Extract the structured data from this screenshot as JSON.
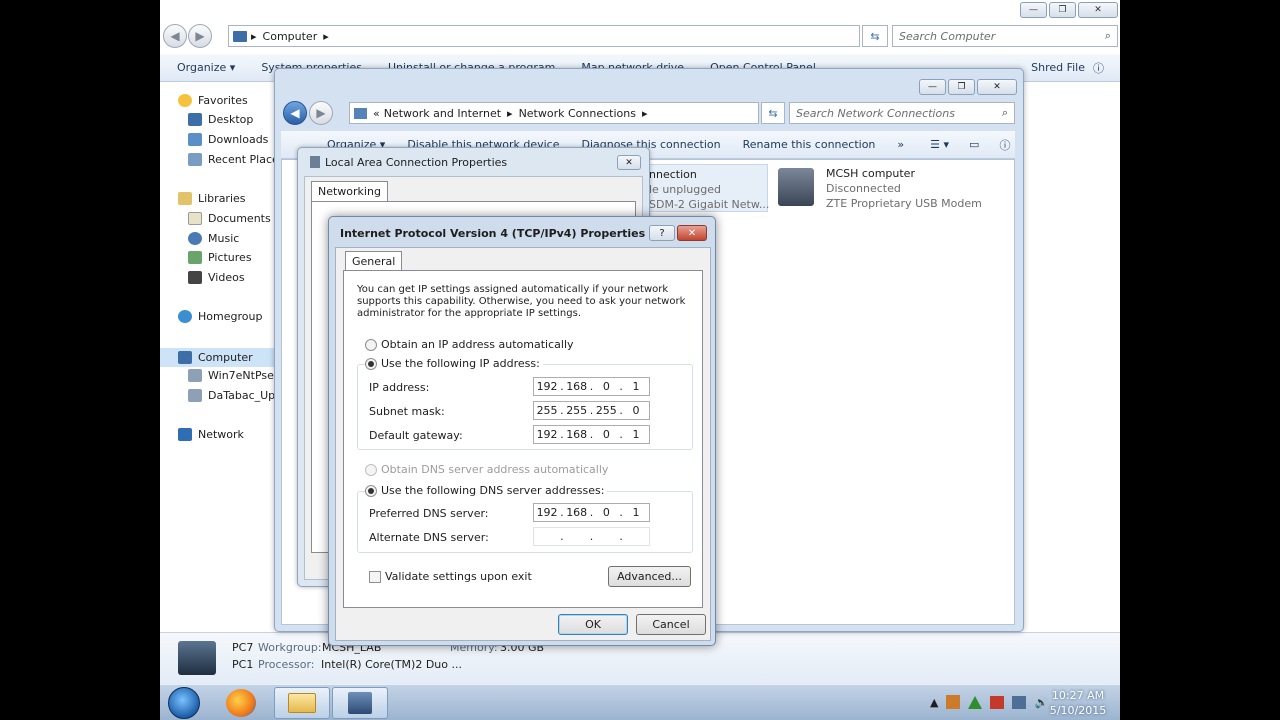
{
  "computer_window": {
    "address": "Computer",
    "search_placeholder": "Search Computer",
    "toolbar": [
      "Organize ▾",
      "System properties",
      "Uninstall or change a program",
      "Map network drive",
      "Open Control Panel"
    ],
    "shred_file": "Shred File",
    "nav": {
      "favorites": "Favorites",
      "desktop": "Desktop",
      "downloads": "Downloads",
      "recent_places": "Recent Places",
      "libraries": "Libraries",
      "documents": "Documents",
      "music": "Music",
      "pictures": "Pictures",
      "videos": "Videos",
      "homegroup": "Homegroup",
      "computer": "Computer",
      "drive1": "Win7eNtPse (",
      "drive2": "DaTabac_Up (",
      "network": "Network"
    },
    "details": {
      "name1": "PC7",
      "workgroup_label": "Workgroup:",
      "workgroup_value": "MCSH_LAB",
      "memory_label": "Memory:",
      "memory_value": "3.00 GB",
      "name2": "PC1",
      "processor_label": "Processor:",
      "processor_value": "Intel(R) Core(TM)2 Duo ..."
    }
  },
  "network_window": {
    "breadcrumb": [
      "«",
      "Network and Internet",
      "Network Connections"
    ],
    "search_placeholder": "Search Network Connections",
    "toolbar": [
      "Organize ▾",
      "Disable this network device",
      "Diagnose this connection",
      "Rename this connection",
      "»"
    ],
    "conn1": {
      "name": "nnection",
      "status": "le unplugged",
      "device": "SDM-2 Gigabit Netw..."
    },
    "conn2": {
      "name": "MCSH computer",
      "status": "Disconnected",
      "device": "ZTE Proprietary USB Modem"
    }
  },
  "lan_dialog": {
    "title": "Local Area Connection Properties",
    "tab": "Networking"
  },
  "ipv4_dialog": {
    "title": "Internet Protocol Version 4 (TCP/IPv4) Properties",
    "tab": "General",
    "description": "You can get IP settings assigned automatically if your network supports this capability. Otherwise, you need to ask your network administrator for the appropriate IP settings.",
    "obtain_ip_auto": "Obtain an IP address automatically",
    "use_following_ip": "Use the following IP address:",
    "ip_label": "IP address:",
    "ip_value": [
      "192",
      "168",
      "0",
      "1"
    ],
    "subnet_label": "Subnet mask:",
    "subnet_value": [
      "255",
      "255",
      "255",
      "0"
    ],
    "gateway_label": "Default gateway:",
    "gateway_value": [
      "192",
      "168",
      "0",
      "1"
    ],
    "obtain_dns_auto": "Obtain DNS server address automatically",
    "use_following_dns": "Use the following DNS server addresses:",
    "preferred_dns_label": "Preferred DNS server:",
    "preferred_dns_value": [
      "192",
      "168",
      "0",
      "1"
    ],
    "alternate_dns_label": "Alternate DNS server:",
    "alternate_dns_value": [
      "",
      "",
      "",
      ""
    ],
    "validate_label": "Validate settings upon exit",
    "advanced_label": "Advanced...",
    "ok_label": "OK",
    "cancel_label": "Cancel",
    "help_glyph": "?",
    "close_glyph": "✕"
  },
  "taskbar": {
    "time": "10:27 AM",
    "date": "5/10/2015"
  }
}
